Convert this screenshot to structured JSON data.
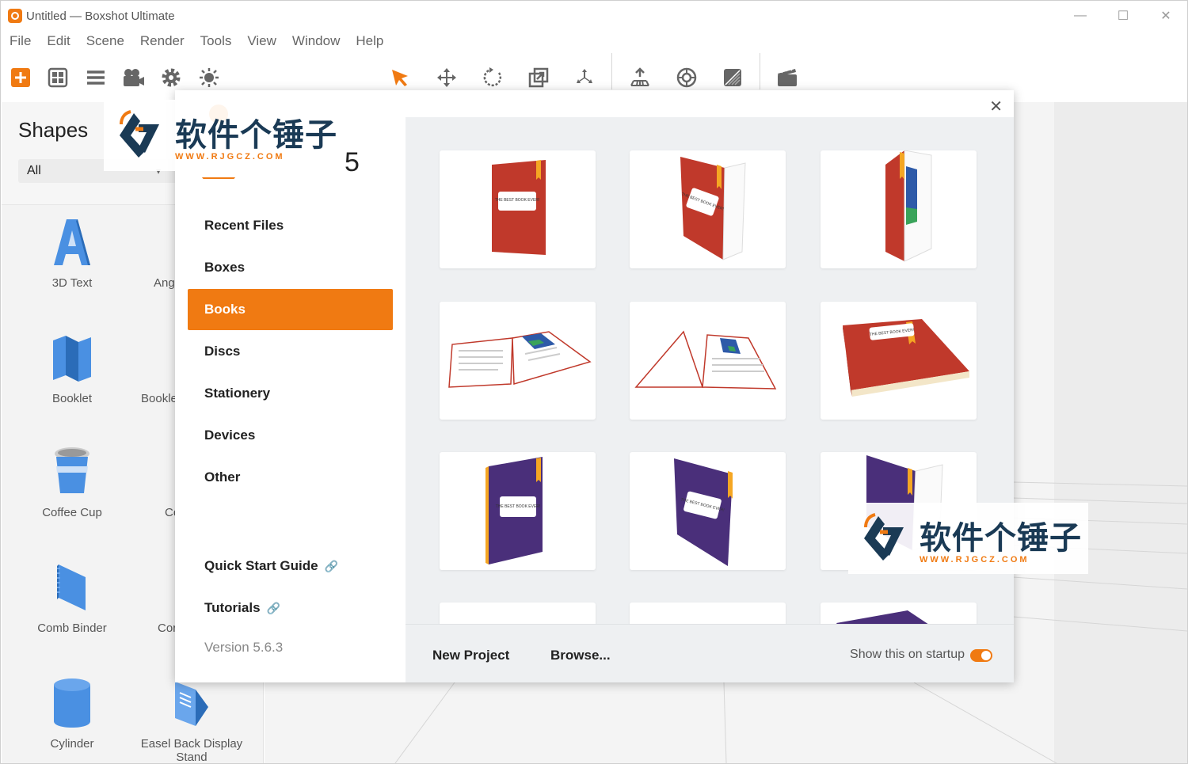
{
  "window": {
    "title": "Untitled — Boxshot Ultimate",
    "controls": {
      "minimize": "—",
      "maximize": "☐",
      "close": "✕"
    }
  },
  "menu": [
    "File",
    "Edit",
    "Scene",
    "Render",
    "Tools",
    "View",
    "Window",
    "Help"
  ],
  "toolbar": {
    "icons": [
      "add-icon",
      "grid-icon",
      "list-icon",
      "camera-icon",
      "gear-icon",
      "light-icon",
      "select-arrow-icon",
      "move-icon",
      "rotate-icon",
      "scale-icon",
      "pivot-icon",
      "floor-icon",
      "focus-icon",
      "material-icon",
      "render-icon"
    ]
  },
  "shapes_panel": {
    "title": "Shapes",
    "filter_value": "All",
    "items": [
      {
        "label": "3D Text"
      },
      {
        "label": "Ang"
      },
      {
        "label": "Booklet"
      },
      {
        "label": "Bookle"
      },
      {
        "label": "Coffee Cup"
      },
      {
        "label": "Co"
      },
      {
        "label": "Comb Binder"
      },
      {
        "label": "Cor"
      },
      {
        "label": "Cylinder"
      },
      {
        "label": "Easel Back Display Stand"
      }
    ]
  },
  "dialog": {
    "logo_number": "5",
    "close": "✕",
    "categories": [
      "Recent Files",
      "Boxes",
      "Books",
      "Discs",
      "Stationery",
      "Devices",
      "Other"
    ],
    "active_category": "Books",
    "links": [
      {
        "label": "Quick Start Guide",
        "icon": "external-link-icon"
      },
      {
        "label": "Tutorials",
        "icon": "external-link-icon"
      }
    ],
    "link_glyph": "🔗",
    "version": "Version 5.6.3",
    "thumbnails": [
      {
        "cover_text": "THE BEST BOOK EVER!",
        "color": "#c0392b"
      },
      {
        "cover_text": "THE BEST BOOK EVER!",
        "color": "#c0392b"
      },
      {
        "cover_text": "",
        "color": "#c0392b"
      },
      {
        "cover_text": "",
        "color": "#ffffff"
      },
      {
        "cover_text": "",
        "color": "#ffffff"
      },
      {
        "cover_text": "THE BEST BOOK EVER!",
        "color": "#c0392b"
      },
      {
        "cover_text": "THE BEST BOOK EVER!",
        "color": "#4a2f7a"
      },
      {
        "cover_text": "THE BEST BOOK EVER!",
        "color": "#4a2f7a"
      },
      {
        "cover_text": "",
        "color": "#4a2f7a"
      }
    ],
    "footer": {
      "new_project": "New Project",
      "browse": "Browse...",
      "show_on_startup": "Show this on startup",
      "show_on_startup_enabled": true
    }
  },
  "watermark": {
    "title": "软件个锤子",
    "url": "WWW.RJGCZ.COM"
  },
  "colors": {
    "accent": "#f07a12",
    "watermark_text": "#1a3a55",
    "book_red": "#c0392b",
    "book_purple": "#4a2f7a",
    "book_band": "#f5a623"
  }
}
